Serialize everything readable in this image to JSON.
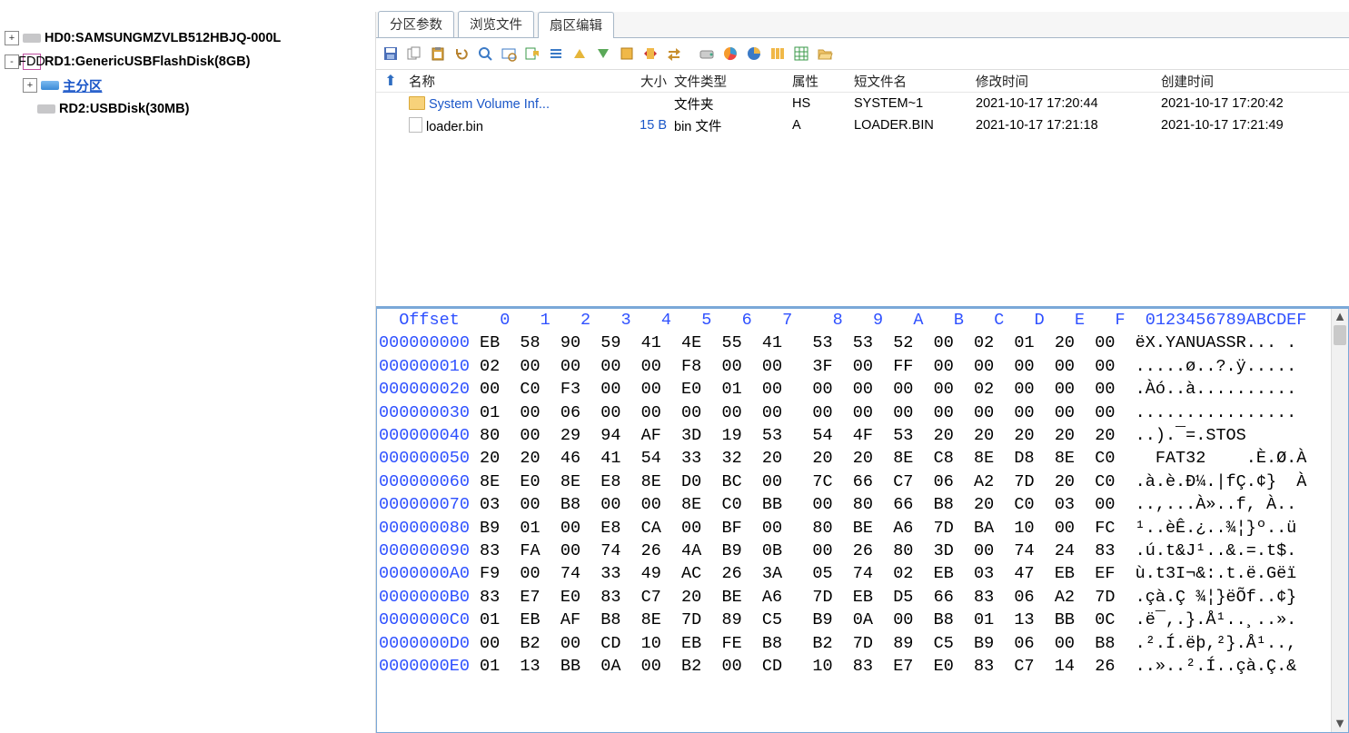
{
  "tree": {
    "nodes": [
      {
        "toggle": "+",
        "indent": 0,
        "icon": "hd",
        "label": "HD0:SAMSUNGMZVLB512HBJQ-000L",
        "cls": ""
      },
      {
        "toggle": "-",
        "indent": 0,
        "icon": "fdd",
        "label": "RD1:GenericUSBFlashDisk(8GB)",
        "cls": ""
      },
      {
        "toggle": "+",
        "indent": 1,
        "icon": "part",
        "label": "主分区",
        "cls": "link"
      },
      {
        "toggle": "",
        "indent": 1,
        "icon": "usb",
        "label": "RD2:USBDisk(30MB)",
        "cls": ""
      }
    ]
  },
  "tabs": [
    {
      "label": "分区参数",
      "active": false
    },
    {
      "label": "浏览文件",
      "active": false
    },
    {
      "label": "扇区编辑",
      "active": true
    }
  ],
  "filelist": {
    "headers": {
      "name": "名称",
      "size": "大小",
      "type": "文件类型",
      "attr": "属性",
      "short": "短文件名",
      "mod": "修改时间",
      "cre": "创建时间"
    },
    "rows": [
      {
        "icon": "folder",
        "name": "System Volume Inf...",
        "name_link": true,
        "size": "",
        "type": "文件夹",
        "attr": "HS",
        "short": "SYSTEM~1",
        "mod": "2021-10-17 17:20:44",
        "cre": "2021-10-17 17:20:42"
      },
      {
        "icon": "file",
        "name": "loader.bin",
        "name_link": false,
        "size": "15 B",
        "type": "bin 文件",
        "attr": "A",
        "short": "LOADER.BIN",
        "mod": "2021-10-17 17:21:18",
        "cre": "2021-10-17 17:21:49"
      }
    ]
  },
  "hex": {
    "header_offset": "  Offset  ",
    "header_cols": "  0   1   2   3   4   5   6   7    8   9   A   B   C   D   E   F ",
    "header_ascii": " 0123456789ABCDEF",
    "rows": [
      {
        "off": "000000000",
        "h": " EB  58  90  59  41  4E  55  41   53  53  52  00  02  01  20  00 ",
        "a": " ëX.YANUASSR... ."
      },
      {
        "off": "000000010",
        "h": " 02  00  00  00  00  F8  00  00   3F  00  FF  00  00  00  00  00 ",
        "a": " .....ø..?.ÿ....."
      },
      {
        "off": "000000020",
        "h": " 00  C0  F3  00  00  E0  01  00   00  00  00  00  02  00  00  00 ",
        "a": " .Àó..à.........."
      },
      {
        "off": "000000030",
        "h": " 01  00  06  00  00  00  00  00   00  00  00  00  00  00  00  00 ",
        "a": " ................"
      },
      {
        "off": "000000040",
        "h": " 80  00  29  94  AF  3D  19  53   54  4F  53  20  20  20  20  20 ",
        "a": " ..).¯=.STOS     "
      },
      {
        "off": "000000050",
        "h": " 20  20  46  41  54  33  32  20   20  20  8E  C8  8E  D8  8E  C0 ",
        "a": "   FAT32    .È.Ø.À"
      },
      {
        "off": "000000060",
        "h": " 8E  E0  8E  E8  8E  D0  BC  00   7C  66  C7  06  A2  7D  20  C0 ",
        "a": " .à.è.Ð¼.|fÇ.¢}  À"
      },
      {
        "off": "000000070",
        "h": " 03  00  B8  00  00  8E  C0  BB   00  80  66  B8  20  C0  03  00 ",
        "a": " ..,...À»..f, À.."
      },
      {
        "off": "000000080",
        "h": " B9  01  00  E8  CA  00  BF  00   80  BE  A6  7D  BA  10  00  FC ",
        "a": " ¹..èÊ.¿..¾¦}º..ü"
      },
      {
        "off": "000000090",
        "h": " 83  FA  00  74  26  4A  B9  0B   00  26  80  3D  00  74  24  83 ",
        "a": " .ú.t&J¹..&.=.t$."
      },
      {
        "off": "0000000A0",
        "h": " F9  00  74  33  49  AC  26  3A   05  74  02  EB  03  47  EB  EF ",
        "a": " ù.t3I¬&:.t.ë.Gëï"
      },
      {
        "off": "0000000B0",
        "h": " 83  E7  E0  83  C7  20  BE  A6   7D  EB  D5  66  83  06  A2  7D ",
        "a": " .çà.Ç ¾¦}ëÕf..¢}"
      },
      {
        "off": "0000000C0",
        "h": " 01  EB  AF  B8  8E  7D  89  C5   B9  0A  00  B8  01  13  BB  0C ",
        "a": " .ë¯,.}.Å¹..¸..»."
      },
      {
        "off": "0000000D0",
        "h": " 00  B2  00  CD  10  EB  FE  B8   B2  7D  89  C5  B9  06  00  B8 ",
        "a": " .².Í.ëþ,²}.Å¹..,"
      },
      {
        "off": "0000000E0",
        "h": " 01  13  BB  0A  00  B2  00  CD   10  83  E7  E0  83  C7  14  26 ",
        "a": " ..»..².Í..çà.Ç.&"
      }
    ]
  }
}
